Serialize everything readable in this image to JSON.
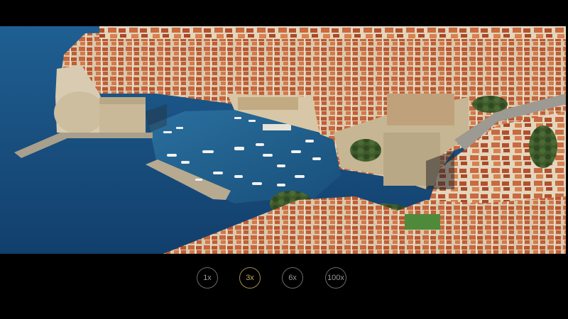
{
  "zoom": {
    "options": [
      {
        "label": "1x",
        "active": false
      },
      {
        "label": "3x",
        "active": true
      },
      {
        "label": "6x",
        "active": false
      },
      {
        "label": "100x",
        "active": false
      }
    ]
  },
  "colors": {
    "background": "#000000",
    "sea": "#1b5a8e",
    "roof": "#c8673e",
    "stone": "#cdbfa8",
    "active_accent": "#c9a961",
    "inactive_text": "#9a9a9a"
  },
  "icons": {
    "preview": "camera-preview-image"
  }
}
